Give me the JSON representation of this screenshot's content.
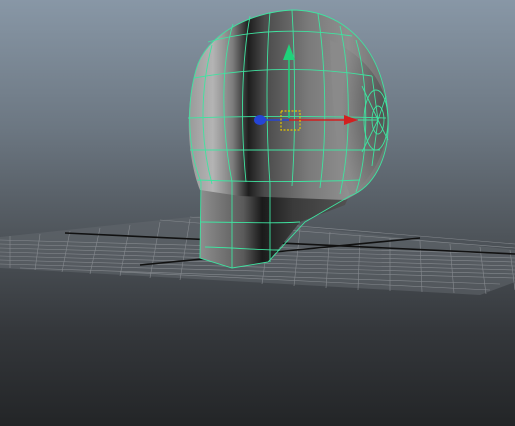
{
  "viewport": {
    "panel": "perspective",
    "background_top": "#8897a6",
    "background_bottom": "#232527"
  },
  "scene": {
    "object": "head-mesh",
    "selection_mode": "object",
    "wireframe_on_shaded": true,
    "wireframe_color": "#3fe3a0",
    "mesh_shade_light": "#a5a5a5",
    "mesh_shade_dark": "#2f2f2f"
  },
  "grid": {
    "visible": true,
    "line_color": "#8b8f94",
    "axis_color": "#111111"
  },
  "manipulator": {
    "tool": "move",
    "x_axis_color": "#d21f1f",
    "y_axis_color": "#1fd27a",
    "z_axis_color": "#2545d6",
    "center_color": "#e2c400"
  }
}
